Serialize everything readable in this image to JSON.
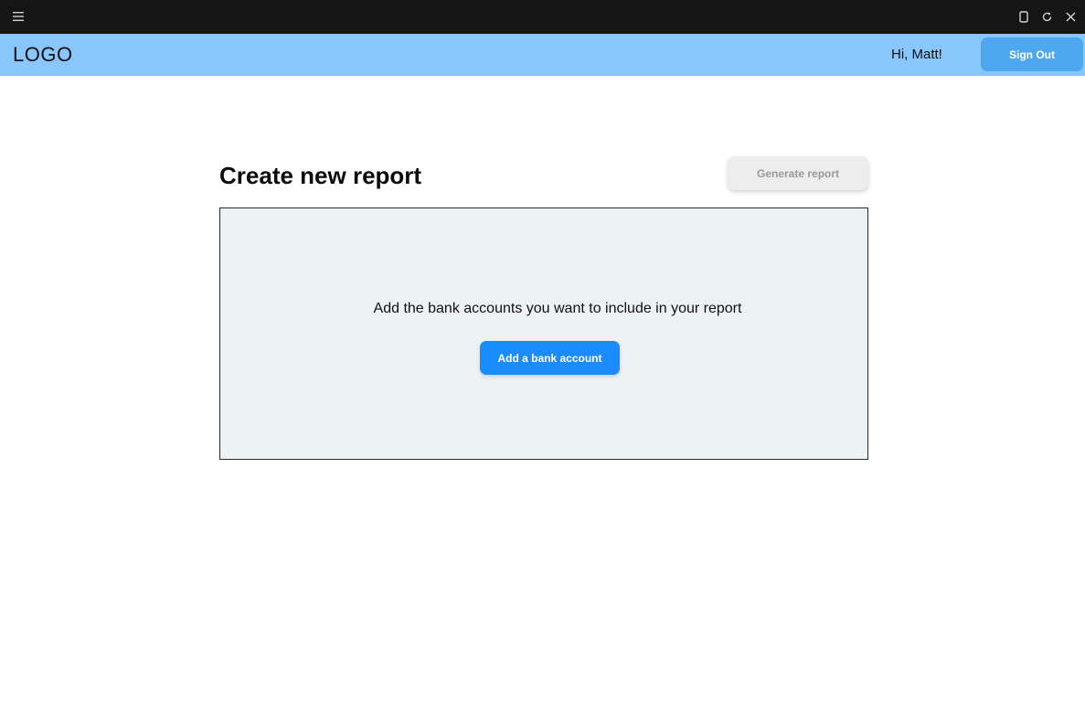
{
  "chrome": {
    "menu_icon": "hamburger-menu-icon",
    "buttons": [
      "phone-icon",
      "reload-icon",
      "close-icon"
    ],
    "background": "#151515"
  },
  "header": {
    "logo": "LOGO",
    "greeting": "Hi, Matt!",
    "signout_label": "Sign Out",
    "background": "#89c6fb",
    "signout_color": "#4ea8f0"
  },
  "main": {
    "title": "Create new report",
    "generate_label": "Generate report",
    "generate_disabled": true,
    "prompt": "Add the bank accounts you want to include in your report",
    "add_button_label": "Add a bank account",
    "accent": "#1a8cff",
    "panel_background": "#edf2f5"
  }
}
